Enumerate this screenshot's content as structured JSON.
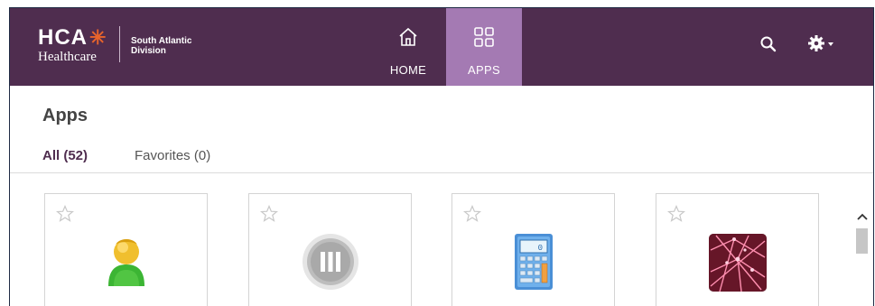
{
  "brand": {
    "logo_text": "HCA",
    "logo_sub": "Healthcare",
    "division_line1": "South Atlantic",
    "division_line2": "Division"
  },
  "nav": {
    "items": [
      {
        "label": "HOME",
        "icon": "home-icon",
        "active": false
      },
      {
        "label": "APPS",
        "icon": "apps-grid-icon",
        "active": true
      }
    ]
  },
  "header_actions": {
    "search_icon": "search-icon",
    "settings_icon": "gear-icon"
  },
  "page": {
    "title": "Apps"
  },
  "tabs": [
    {
      "label": "All (52)",
      "active": true
    },
    {
      "label": "Favorites (0)",
      "active": false
    }
  ],
  "apps": [
    {
      "icon": "user-profile-icon"
    },
    {
      "icon": "pause-circle-icon"
    },
    {
      "icon": "calculator-icon"
    },
    {
      "icon": "network-mesh-icon"
    }
  ],
  "colors": {
    "header_bg": "#4f2d4f",
    "active_nav": "#a47ab3",
    "accent_orange": "#e8642b"
  }
}
